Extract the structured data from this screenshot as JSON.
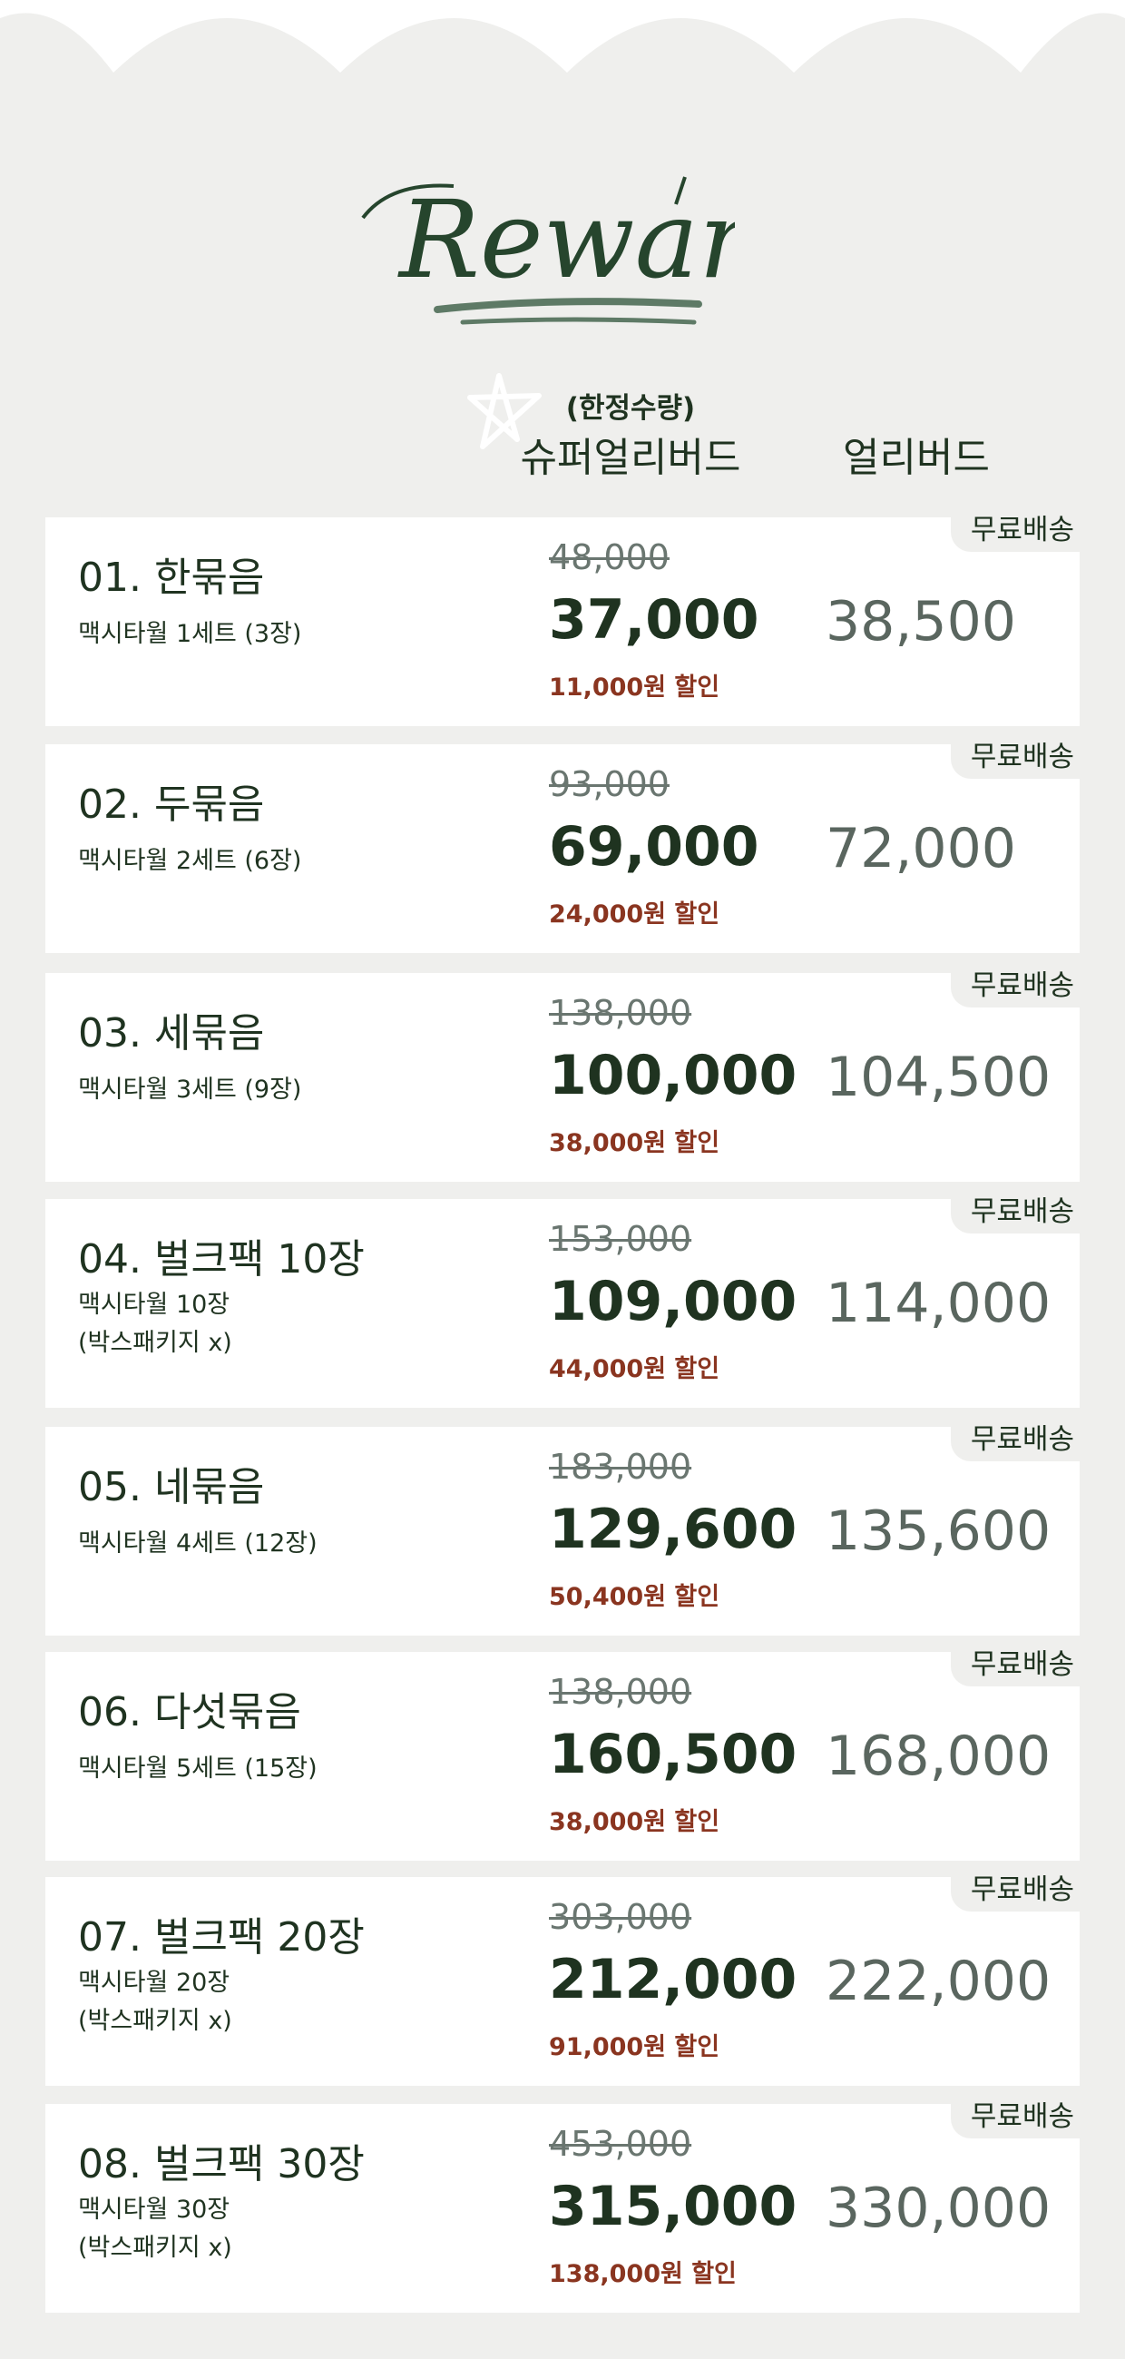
{
  "header": {
    "logo_text": "Reward",
    "limited_label": "(한정수량)",
    "super_early_label": "슈퍼얼리버드",
    "early_label": "얼리버드"
  },
  "colors": {
    "background": "#efefed",
    "card": "#ffffff",
    "text_dark": "#1f3320",
    "original_price": "#6a7670",
    "discount": "#8a3520",
    "early_price": "#5a665f"
  },
  "rewards": [
    {
      "title": "01. 한묶음",
      "subtitle": [
        "맥시타월 1세트 (3장)"
      ],
      "badge": "무료배송",
      "original_price": "48,000",
      "super_price": "37,000",
      "discount": "11,000원 할인",
      "early_price": "38,500"
    },
    {
      "title": "02. 두묶음",
      "subtitle": [
        "맥시타월 2세트 (6장)"
      ],
      "badge": "무료배송",
      "original_price": "93,000",
      "super_price": "69,000",
      "discount": "24,000원 할인",
      "early_price": "72,000"
    },
    {
      "title": "03. 세묶음",
      "subtitle": [
        "맥시타월 3세트 (9장)"
      ],
      "badge": "무료배송",
      "original_price": "138,000",
      "super_price": "100,000",
      "discount": "38,000원 할인",
      "early_price": "104,500"
    },
    {
      "title": "04. 벌크팩 10장",
      "subtitle": [
        "맥시타월 10장",
        "(박스패키지 x)"
      ],
      "badge": "무료배송",
      "original_price": "153,000",
      "super_price": "109,000",
      "discount": "44,000원 할인",
      "early_price": "114,000"
    },
    {
      "title": "05. 네묶음",
      "subtitle": [
        "맥시타월 4세트 (12장)"
      ],
      "badge": "무료배송",
      "original_price": "183,000",
      "super_price": "129,600",
      "discount": "50,400원 할인",
      "early_price": "135,600"
    },
    {
      "title": "06. 다섯묶음",
      "subtitle": [
        "맥시타월 5세트 (15장)"
      ],
      "badge": "무료배송",
      "original_price": "138,000",
      "super_price": "160,500",
      "discount": "38,000원 할인",
      "early_price": "168,000"
    },
    {
      "title": "07. 벌크팩 20장",
      "subtitle": [
        "맥시타월 20장",
        "(박스패키지 x)"
      ],
      "badge": "무료배송",
      "original_price": "303,000",
      "super_price": "212,000",
      "discount": "91,000원 할인",
      "early_price": "222,000"
    },
    {
      "title": "08. 벌크팩 30장",
      "subtitle": [
        "맥시타월 30장",
        "(박스패키지 x)"
      ],
      "badge": "무료배송",
      "original_price": "453,000",
      "super_price": "315,000",
      "discount": "138,000원 할인",
      "early_price": "330,000"
    }
  ]
}
